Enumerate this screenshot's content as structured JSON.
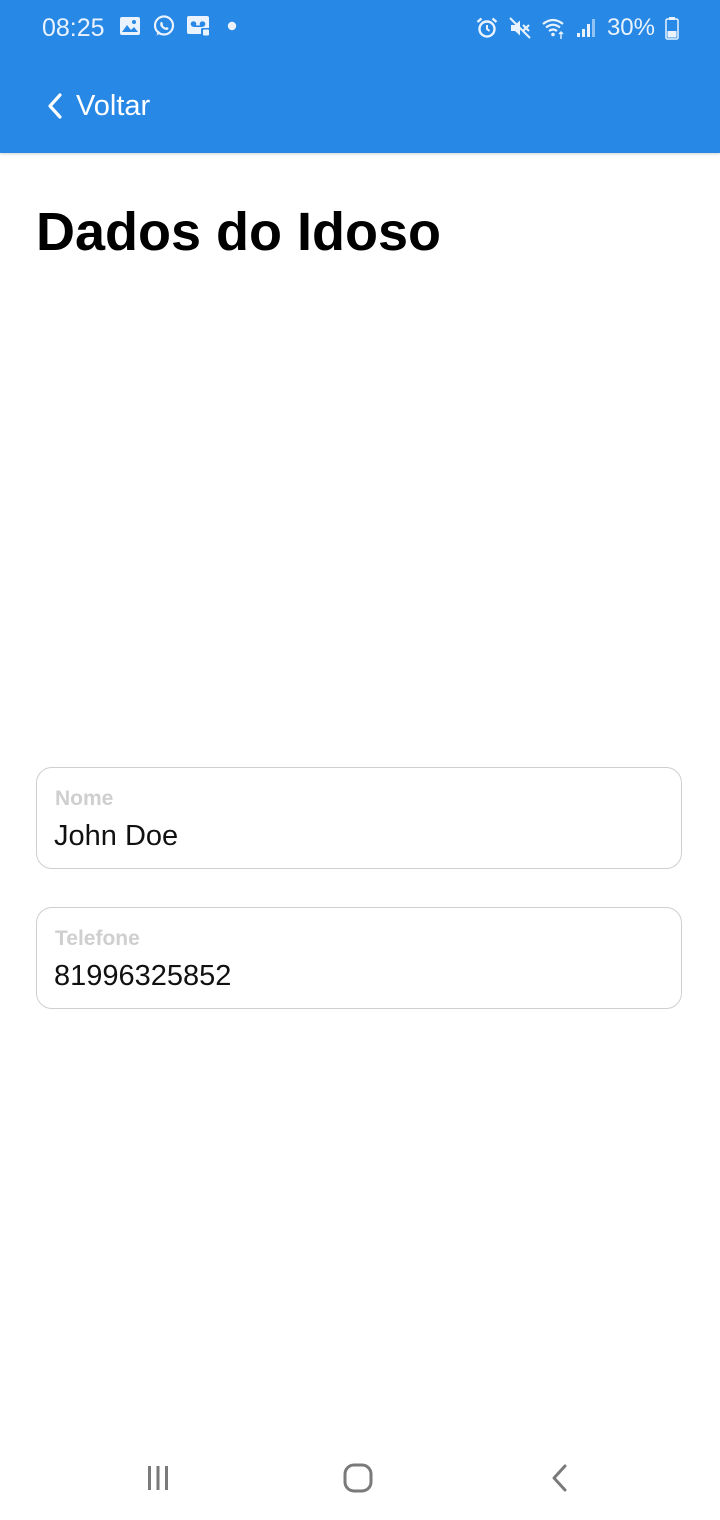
{
  "status_bar": {
    "time": "08:25",
    "battery_percent": "30%",
    "left_icons": [
      "gallery-icon",
      "whatsapp-icon",
      "voicemail-icon",
      "dot-icon"
    ],
    "right_icons": [
      "alarm-icon",
      "mute-icon",
      "wifi-icon",
      "signal-icon",
      "battery-icon"
    ]
  },
  "header": {
    "back_label": "Voltar",
    "background_color": "#2788e6"
  },
  "page": {
    "title": "Dados do Idoso"
  },
  "form": {
    "name_field": {
      "label": "Nome",
      "value": "John Doe"
    },
    "phone_field": {
      "label": "Telefone",
      "value": "81996325852"
    }
  },
  "nav_bar": {
    "buttons": [
      "recents-icon",
      "home-icon",
      "back-icon"
    ]
  }
}
